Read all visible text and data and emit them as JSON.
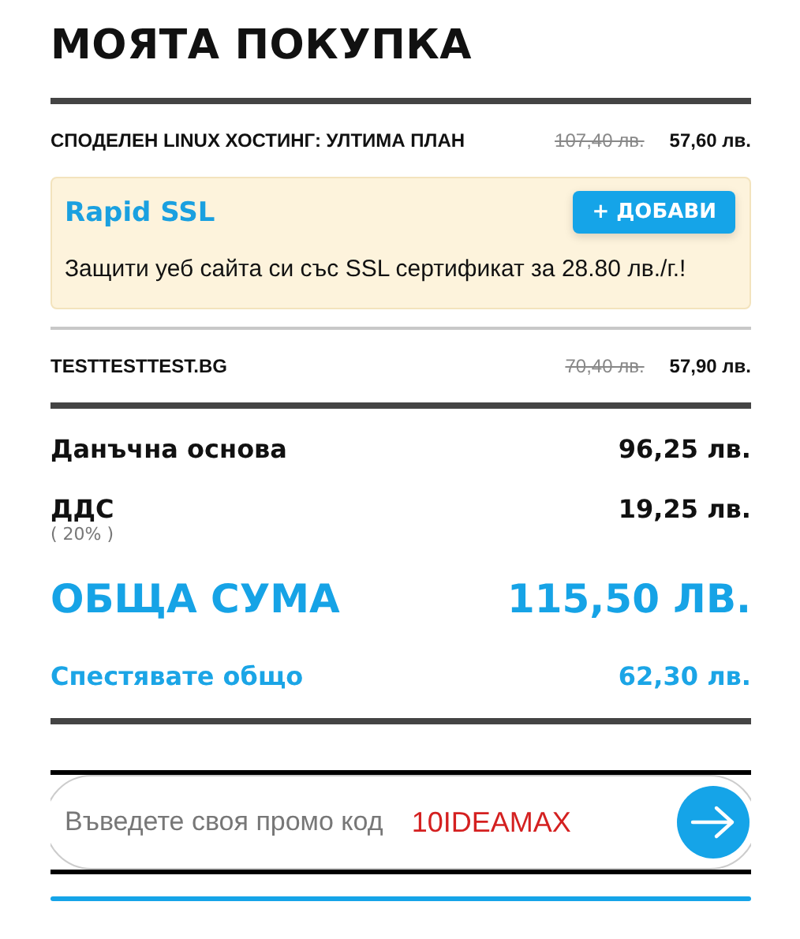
{
  "title": "МОЯТА ПОКУПКА",
  "items": [
    {
      "name": "СПОДЕЛЕН LINUX ХОСТИНГ: УЛТИМА ПЛАН",
      "old_price": "107,40 лв.",
      "price": "57,60 лв.",
      "upsell": {
        "title": "Rapid SSL",
        "button": "+ ДОБАВИ",
        "text": "Защити уеб сайта си със SSL сертификат за 28.80 лв./г.!"
      }
    },
    {
      "name": "TESTTESTTEST.BG",
      "old_price": "70,40 лв.",
      "price": "57,90 лв."
    }
  ],
  "summary": [
    {
      "kind": "normal",
      "label": "Данъчна основа",
      "value": "96,25 лв."
    },
    {
      "kind": "normal",
      "label": "ДДС",
      "note": "( 20% )",
      "value": "19,25 лв."
    },
    {
      "kind": "total",
      "label": "ОБЩА СУМА",
      "value": "115,50 ЛВ."
    },
    {
      "kind": "savings",
      "label": "Спестявате общо",
      "value": "62,30 лв."
    }
  ],
  "promo": {
    "placeholder": "Въведете своя промо код",
    "annotation": "10IDEAMAX"
  }
}
